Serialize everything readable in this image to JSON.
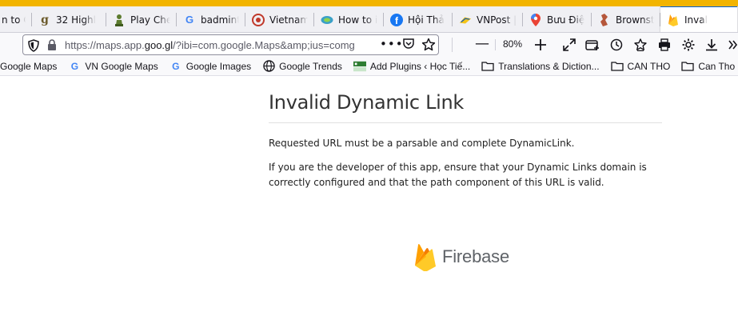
{
  "browser": {
    "accent_color": "#f2b400",
    "active_tab_color": "#0060df",
    "tabs": [
      {
        "label": "n to C",
        "icon": "none"
      },
      {
        "label": "32 Highl",
        "icon": "g-letter-icon"
      },
      {
        "label": "Play Che",
        "icon": "chess-pawn-icon"
      },
      {
        "label": "badmint",
        "icon": "google-g-icon"
      },
      {
        "label": "Vietnam",
        "icon": "red-circle-icon"
      },
      {
        "label": "How to i",
        "icon": "map-icon"
      },
      {
        "label": "Hội Thả",
        "icon": "facebook-icon"
      },
      {
        "label": "VNPost |",
        "icon": "vnpost-icon"
      },
      {
        "label": "Bưu Điệ",
        "icon": "map-pin-icon"
      },
      {
        "label": "Brownst",
        "icon": "brownstone-icon"
      },
      {
        "label": "Inval",
        "icon": "firebase-icon",
        "active": true
      }
    ],
    "url": {
      "prefix": "https://maps.app.",
      "domain": "goo.gl",
      "suffix": "/?ibi=com.google.Maps&amp;ius=comg"
    },
    "zoom": "80%",
    "bookmarks": [
      {
        "label": "Google Maps",
        "icon": "none"
      },
      {
        "label": "VN Google Maps",
        "icon": "google-g-icon"
      },
      {
        "label": "Google Images",
        "icon": "google-g-icon"
      },
      {
        "label": "Google Trends",
        "icon": "globe-icon"
      },
      {
        "label": "Add Plugins ‹ Học Tiế...",
        "icon": "plugin-site-icon"
      },
      {
        "label": "Translations & Diction...",
        "icon": "folder-icon"
      },
      {
        "label": "CAN THO",
        "icon": "folder-icon"
      },
      {
        "label": "Can Tho Restaura",
        "icon": "folder-icon"
      }
    ]
  },
  "page": {
    "title": "Invalid Dynamic Link",
    "message": "Requested URL must be a parsable and complete DynamicLink.",
    "help": "If you are the developer of this app, ensure that your Dynamic Links domain is correctly configured and that the path component of this URL is valid.",
    "brand": "Firebase"
  }
}
